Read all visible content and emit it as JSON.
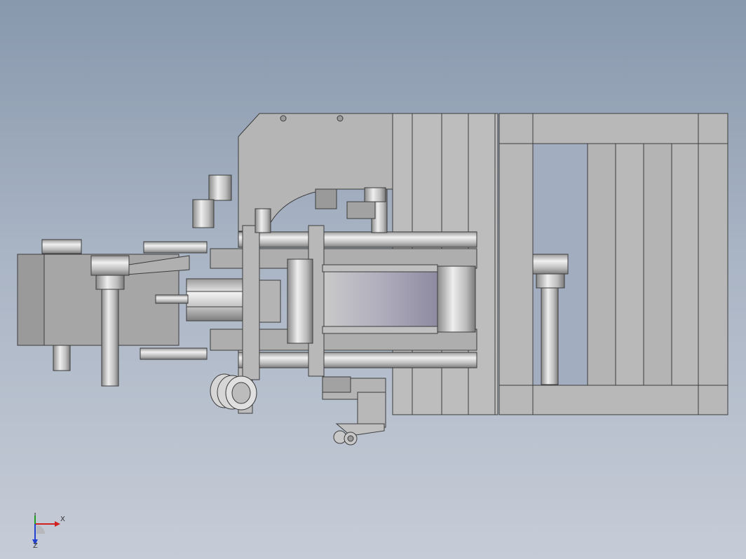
{
  "viewport": {
    "background_top": "#8898ad",
    "background_bottom": "#c6ccd7",
    "model_fill": "#c8c8c8",
    "model_edge": "#3c3c3c"
  },
  "triad": {
    "x_label": "X",
    "y_label": "Y",
    "z_label": "Z",
    "x_color": "#d02020",
    "y_color": "#20a020",
    "z_color": "#2040d0"
  }
}
